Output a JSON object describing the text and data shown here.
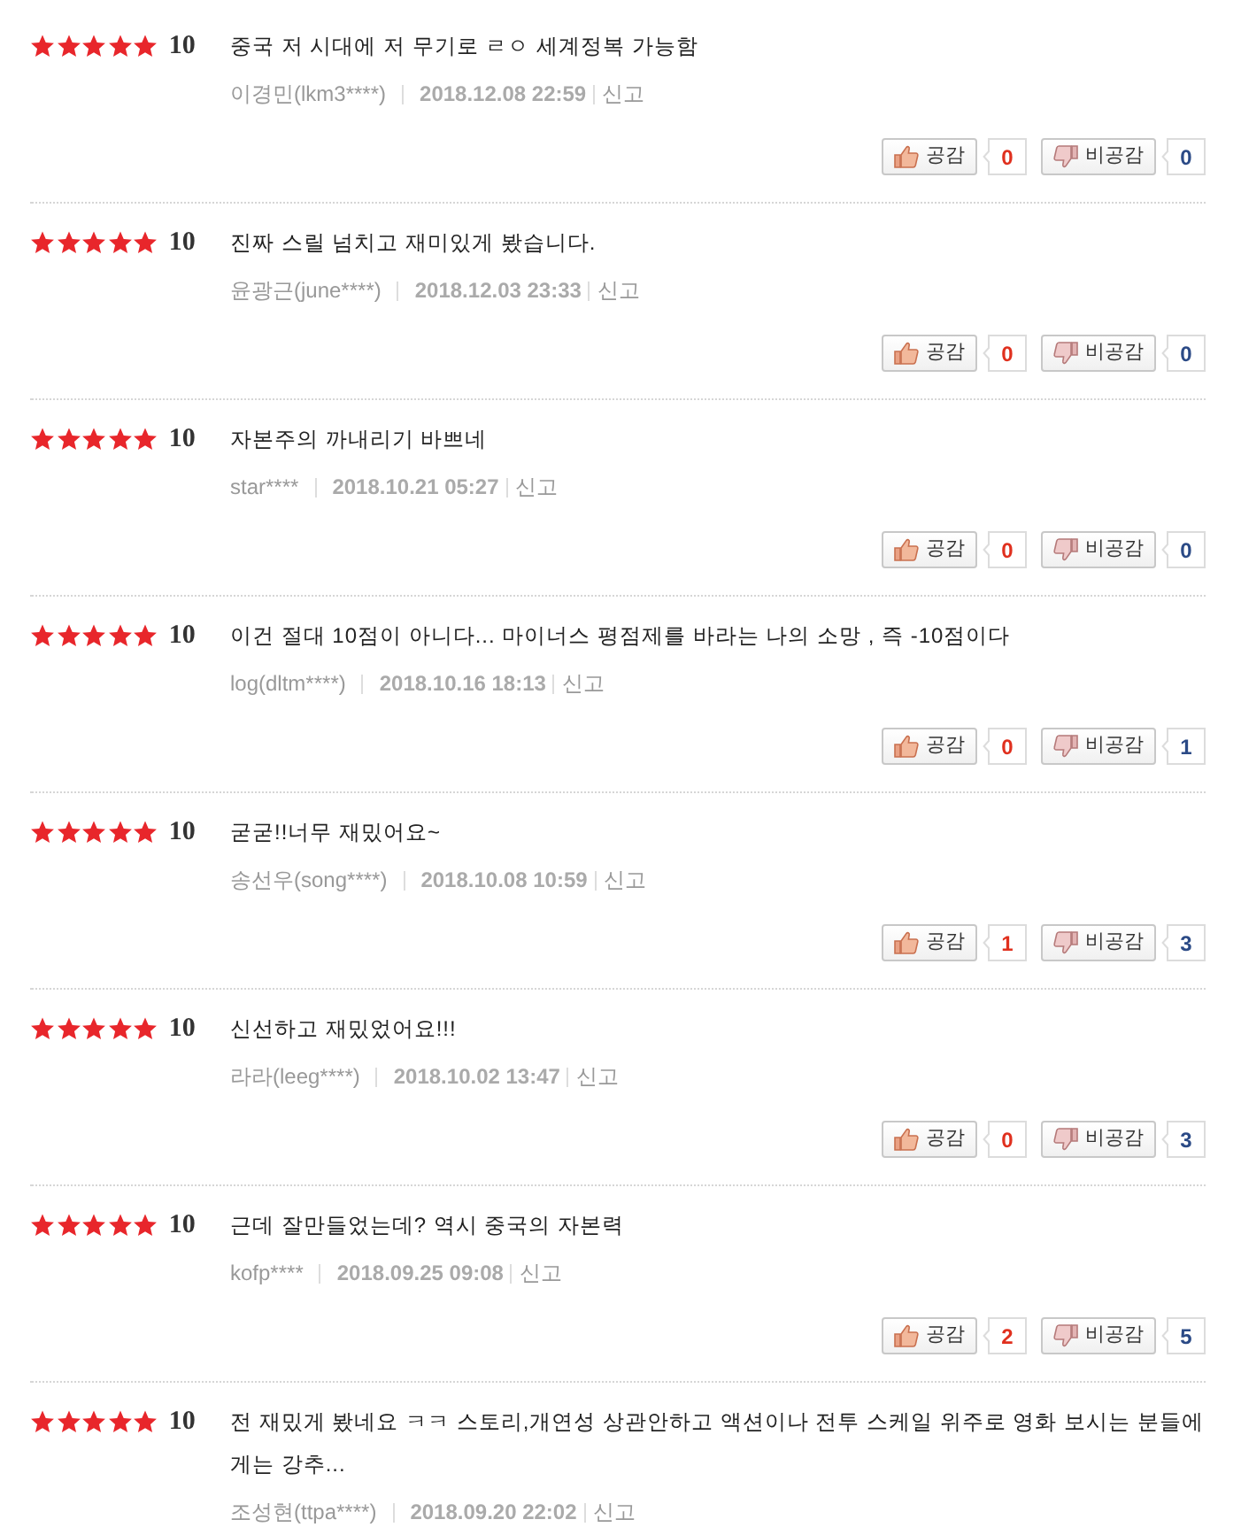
{
  "reviews": [
    {
      "stars": 5,
      "score": "10",
      "text": "중국 저 시대에 저 무기로 ㄹㅇ 세계정복 가능함",
      "author": "이경민(lkm3****)",
      "date": "2018.12.08 22:59",
      "report": "신고",
      "votes": {
        "like_label": "공감",
        "like_count": "0",
        "dislike_label": "비공감",
        "dislike_count": "0"
      }
    },
    {
      "stars": 5,
      "score": "10",
      "text": "진짜 스릴 넘치고 재미있게 봤습니다.",
      "author": "윤광근(june****)",
      "date": "2018.12.03 23:33",
      "report": "신고",
      "votes": {
        "like_label": "공감",
        "like_count": "0",
        "dislike_label": "비공감",
        "dislike_count": "0"
      }
    },
    {
      "stars": 5,
      "score": "10",
      "text": "자본주의 까내리기 바쁘네",
      "author": "star****",
      "date": "2018.10.21 05:27",
      "report": "신고",
      "votes": {
        "like_label": "공감",
        "like_count": "0",
        "dislike_label": "비공감",
        "dislike_count": "0"
      }
    },
    {
      "stars": 5,
      "score": "10",
      "text": "이건 절대 10점이 아니다... 마이너스 평점제를 바라는 나의 소망 , 즉 -10점이다",
      "author": "log(dltm****)",
      "date": "2018.10.16 18:13",
      "report": "신고",
      "votes": {
        "like_label": "공감",
        "like_count": "0",
        "dislike_label": "비공감",
        "dislike_count": "1"
      }
    },
    {
      "stars": 5,
      "score": "10",
      "text": "굳굳!!너무 재밌어요~",
      "author": "송선우(song****)",
      "date": "2018.10.08 10:59",
      "report": "신고",
      "votes": {
        "like_label": "공감",
        "like_count": "1",
        "dislike_label": "비공감",
        "dislike_count": "3"
      }
    },
    {
      "stars": 5,
      "score": "10",
      "text": "신선하고 재밌었어요!!!",
      "author": "라라(leeg****)",
      "date": "2018.10.02 13:47",
      "report": "신고",
      "votes": {
        "like_label": "공감",
        "like_count": "0",
        "dislike_label": "비공감",
        "dislike_count": "3"
      }
    },
    {
      "stars": 5,
      "score": "10",
      "text": "근데 잘만들었는데? 역시 중국의 자본력",
      "author": "kofp****",
      "date": "2018.09.25 09:08",
      "report": "신고",
      "votes": {
        "like_label": "공감",
        "like_count": "2",
        "dislike_label": "비공감",
        "dislike_count": "5"
      }
    },
    {
      "stars": 5,
      "score": "10",
      "text": "전 재밌게 봤네요 ㅋㅋ 스토리,개연성 상관안하고 액션이나 전투 스케일 위주로 영화 보시는 분들에게는 강추...",
      "author": "조성현(ttpa****)",
      "date": "2018.09.20 22:02",
      "report": "신고"
    }
  ]
}
